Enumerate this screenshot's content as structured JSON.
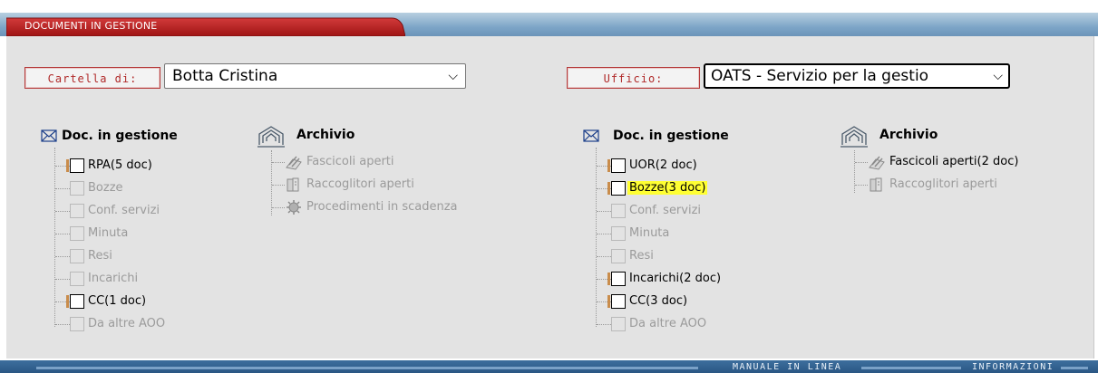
{
  "header": {
    "tab_title": "DOCUMENTI IN GESTIONE"
  },
  "left": {
    "folder_label": "Cartella di:",
    "folder_value": "Botta Cristina",
    "doc_header": "Doc. in gestione",
    "archive_header": "Archivio",
    "doc_items": [
      {
        "label": "RPA(5 doc)",
        "active": true
      },
      {
        "label": "Bozze",
        "active": false
      },
      {
        "label": "Conf. servizi",
        "active": false
      },
      {
        "label": "Minuta",
        "active": false
      },
      {
        "label": "Resi",
        "active": false
      },
      {
        "label": "Incarichi",
        "active": false
      },
      {
        "label": "CC(1 doc)",
        "active": true
      },
      {
        "label": "Da altre AOO",
        "active": false
      }
    ],
    "archive_items": [
      {
        "label": "Fascicoli aperti",
        "icon": "folder-tools-icon",
        "active": false
      },
      {
        "label": "Raccoglitori aperti",
        "icon": "binder-icon",
        "active": false
      },
      {
        "label": "Procedimenti in scadenza",
        "icon": "gear-icon",
        "active": false
      }
    ]
  },
  "right": {
    "office_label": "Ufficio:",
    "office_value": "OATS - Servizio per la gestio",
    "doc_header": "Doc. in gestione",
    "archive_header": "Archivio",
    "doc_items": [
      {
        "label": "UOR(2 doc)",
        "active": true
      },
      {
        "label": "Bozze(3 doc)",
        "active": true,
        "highlighted": true
      },
      {
        "label": "Conf. servizi",
        "active": false
      },
      {
        "label": "Minuta",
        "active": false
      },
      {
        "label": "Resi",
        "active": false
      },
      {
        "label": "Incarichi(2 doc)",
        "active": true
      },
      {
        "label": "CC(3 doc)",
        "active": true
      },
      {
        "label": "Da altre AOO",
        "active": false
      }
    ],
    "archive_items": [
      {
        "label": "Fascicoli aperti(2 doc)",
        "icon": "folder-tools-icon",
        "active": true
      },
      {
        "label": "Raccoglitori aperti",
        "icon": "binder-icon",
        "active": false
      }
    ]
  },
  "footer": {
    "link1": "MANUALE IN LINEA",
    "link2": "INFORMAZIONI"
  },
  "colors": {
    "tab_red": "#b51f1f",
    "highlight": "#ffff33",
    "label_border": "#b53a3a",
    "bar_blue": "#2a5683"
  }
}
